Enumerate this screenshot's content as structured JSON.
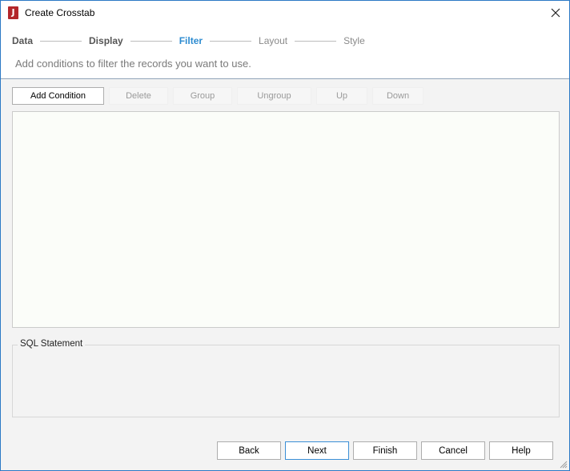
{
  "window": {
    "title": "Create Crosstab",
    "app_icon_letter": "J"
  },
  "steps": [
    {
      "label": "Data",
      "state": "done"
    },
    {
      "label": "Display",
      "state": "done"
    },
    {
      "label": "Filter",
      "state": "active"
    },
    {
      "label": "Layout",
      "state": "pending"
    },
    {
      "label": "Style",
      "state": "pending"
    }
  ],
  "subtitle": "Add conditions to filter the records you want to use.",
  "toolbar": {
    "add_condition": "Add Condition",
    "delete": "Delete",
    "group": "Group",
    "ungroup": "Ungroup",
    "up": "Up",
    "down": "Down"
  },
  "sql": {
    "legend": "SQL Statement"
  },
  "footer": {
    "back": "Back",
    "next": "Next",
    "finish": "Finish",
    "cancel": "Cancel",
    "help": "Help"
  },
  "colors": {
    "accent": "#2c8bd0",
    "app_icon": "#b3262a",
    "window_border": "#2b79c5"
  }
}
